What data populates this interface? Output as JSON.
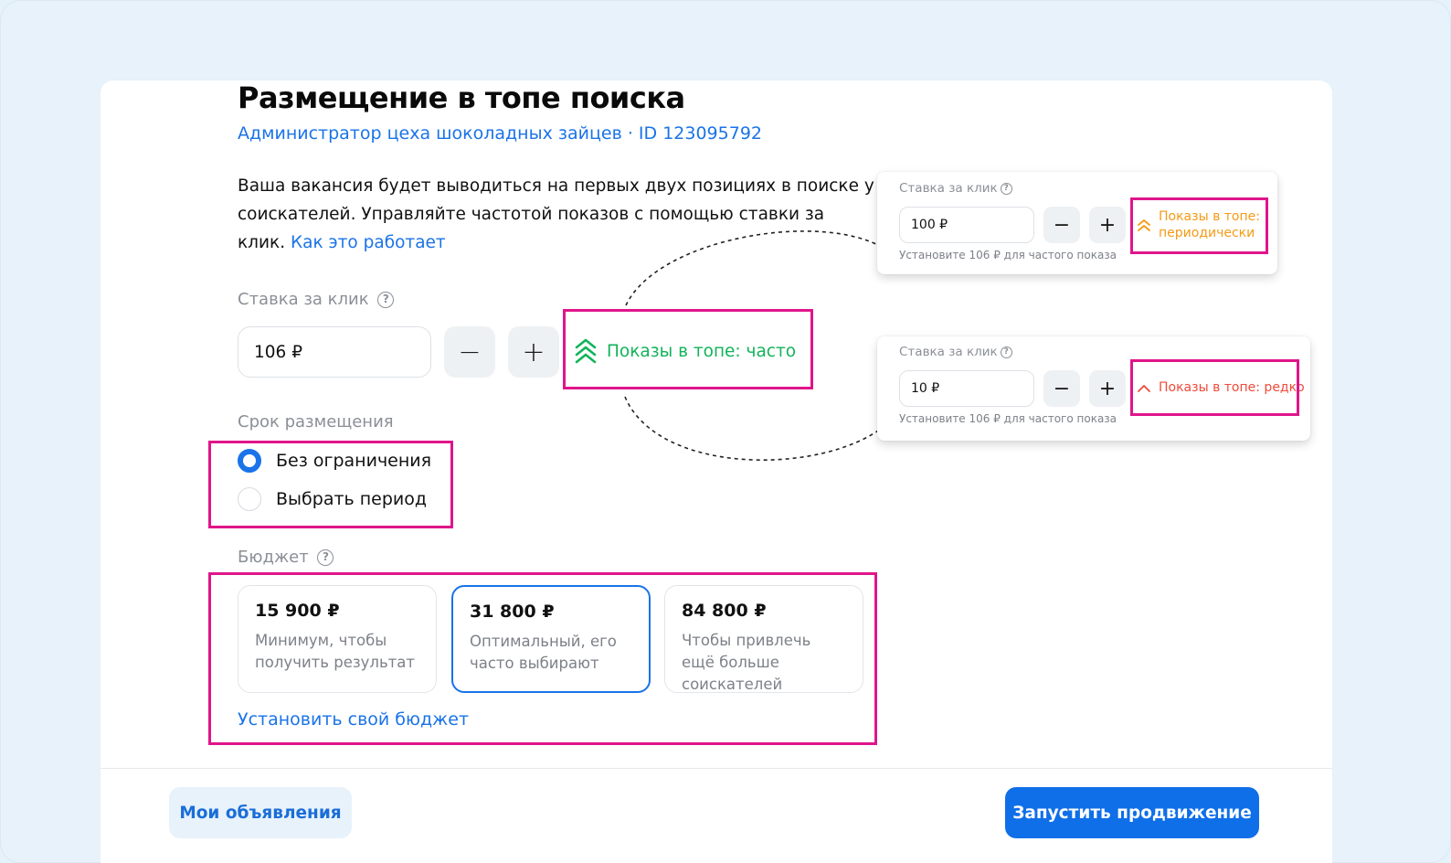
{
  "page": {
    "title": "Размещение в топе поиска",
    "subtitle": "Администратор цеха шоколадных зайцев · ID 123095792",
    "description": "Ваша вакансия будет выводиться на первых двух позициях в поиске у соискателей. Управляйте частотой показов с помощью ставки за клик.",
    "description_link": "Как это работает"
  },
  "bid": {
    "label": "Ставка за клик",
    "help_icon": "question-circle-icon",
    "value": "106 ₽",
    "minus": "−",
    "plus": "+",
    "status": "Показы в топе: часто",
    "status_icon": "triple-chevron-up-icon"
  },
  "duration": {
    "label": "Срок размещения",
    "options": [
      {
        "label": "Без ограничения",
        "selected": true
      },
      {
        "label": "Выбрать период",
        "selected": false
      }
    ]
  },
  "budget": {
    "label": "Бюджет",
    "help_icon": "question-circle-icon",
    "options": [
      {
        "amount": "15 900 ₽",
        "text": "Минимум, чтобы получить результат",
        "selected": false
      },
      {
        "amount": "31 800 ₽",
        "text": "Оптимальный, его часто выбирают",
        "selected": true
      },
      {
        "amount": "84 800 ₽",
        "text": "Чтобы привлечь ещё больше соискателей",
        "selected": false
      }
    ],
    "custom_link": "Установить свой бюджет"
  },
  "footer": {
    "secondary_button": "Мои объявления",
    "primary_button": "Запустить продвижение"
  },
  "examples": [
    {
      "label": "Ставка за клик",
      "value": "100 ₽",
      "hint": "Установите 106 ₽ для частого показа",
      "status": "Показы в топе: периодически",
      "status_color": "#f59a16",
      "status_icon": "double-chevron-up-icon"
    },
    {
      "label": "Ставка за клик",
      "value": "10 ₽",
      "hint": "Установите 106 ₽ для частого показа",
      "status": "Показы в топе: редко",
      "status_color": "#ef4a3a",
      "status_icon": "chevron-up-icon"
    }
  ],
  "colors": {
    "accent": "#1a73e8",
    "highlight": "#e0158a",
    "success": "#12b35a"
  }
}
